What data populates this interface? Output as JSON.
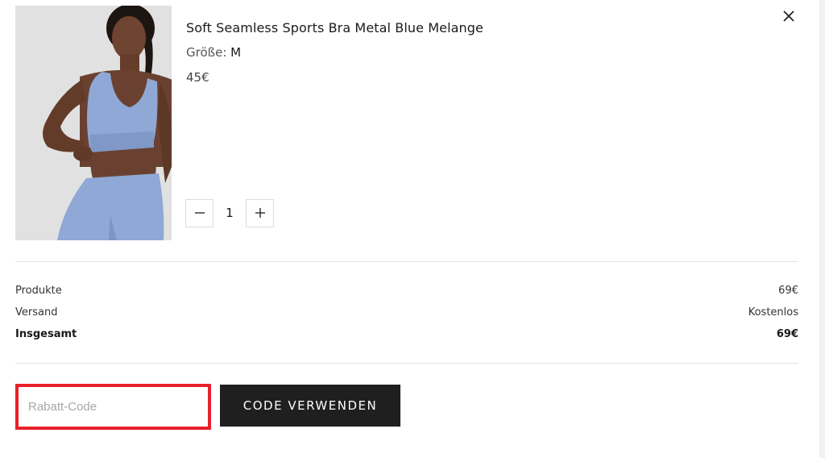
{
  "product": {
    "title": "Soft Seamless Sports Bra Metal Blue Melange",
    "size_label": "Größe: ",
    "size_value": "M",
    "price": "45€",
    "quantity": "1",
    "image_icon": "product-photo"
  },
  "icons": {
    "close": "close-icon",
    "minus": "minus-icon",
    "plus": "plus-icon"
  },
  "summary": {
    "products_label": "Produkte",
    "products_value": "69€",
    "shipping_label": "Versand",
    "shipping_value": "Kostenlos",
    "total_label": "Insgesamt",
    "total_value": "69€"
  },
  "discount": {
    "placeholder": "Rabatt-Code",
    "value": "",
    "button_label": "CODE VERWENDEN",
    "highlight_color": "#e8202a"
  },
  "colors": {
    "button_bg": "#1f1f1f",
    "product_blue": "#8fa8d6"
  }
}
